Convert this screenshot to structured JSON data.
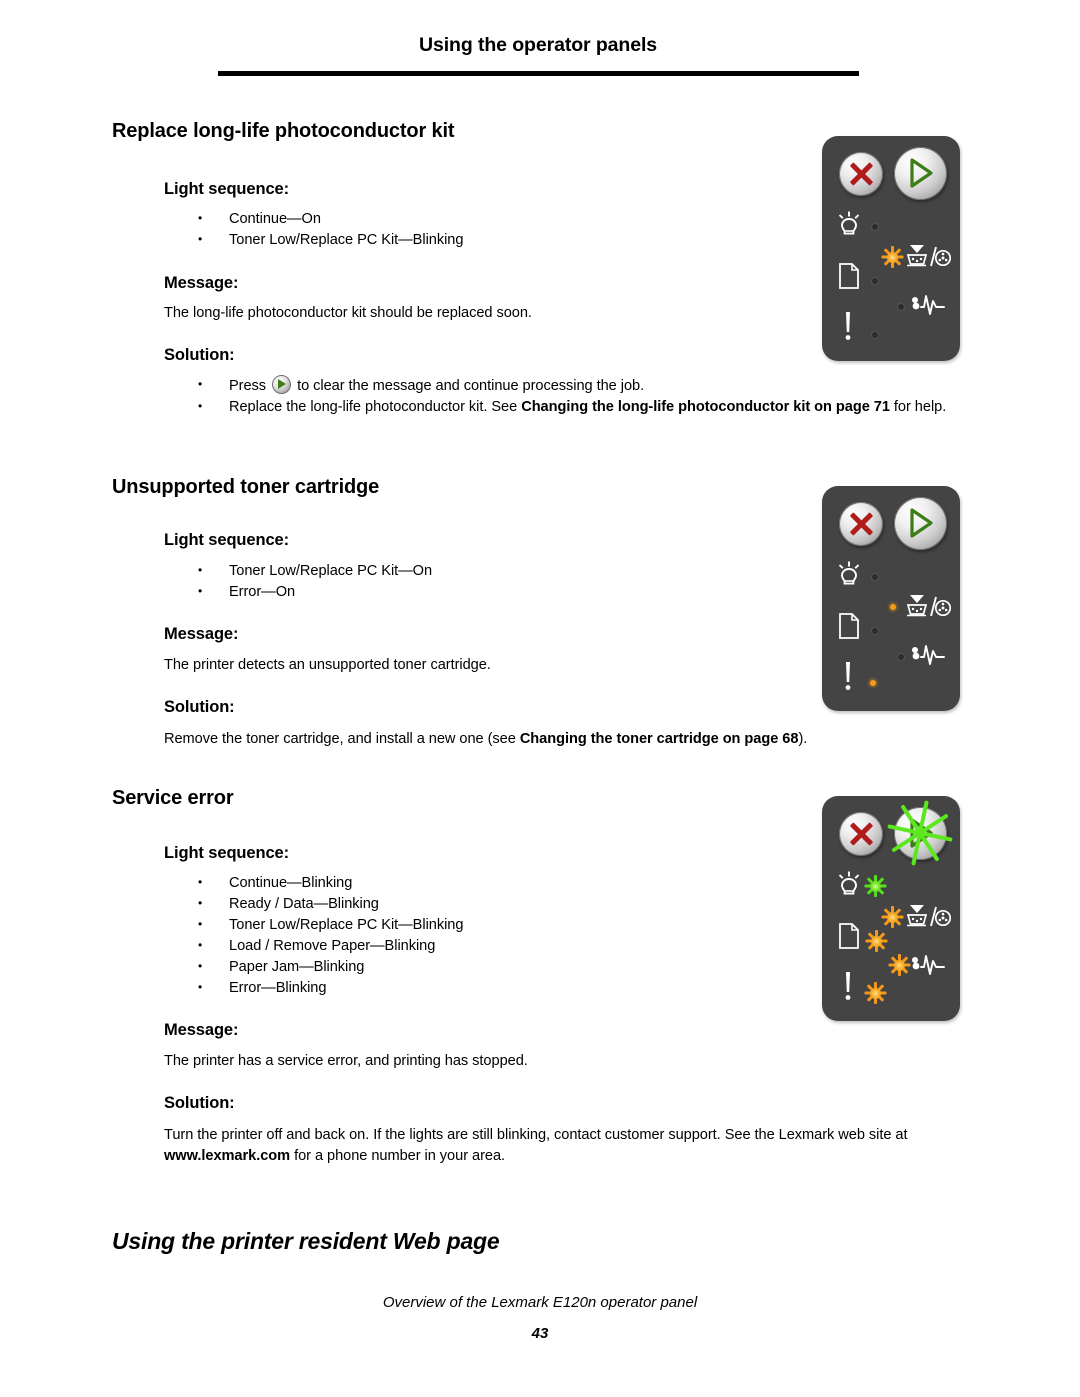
{
  "header": {
    "running_title": "Using the operator panels"
  },
  "sections": [
    {
      "title": "Replace long-life photoconductor kit",
      "light_sequence_label": "Light sequence:",
      "light_sequence": [
        "Continue—On",
        "Toner Low/Replace PC Kit—Blinking"
      ],
      "message_label": "Message:",
      "message": "The long-life photoconductor kit should be replaced soon.",
      "solution_label": "Solution:",
      "solution_bullets": [
        {
          "pre": "Press ",
          "has_button_icon": true,
          "post": " to clear the message and continue processing the job."
        },
        {
          "pre": "Replace the long-life photoconductor kit. See ",
          "bold": "Changing the long-life photoconductor kit on page 71",
          "post": " for help."
        }
      ],
      "panel": {
        "stop_button": "stop-button",
        "continue_button": "continue-button",
        "leds": {
          "ready": "off",
          "toner": "blinking",
          "paper": "off",
          "jam": "off",
          "error": "off",
          "continue": "on"
        }
      }
    },
    {
      "title": "Unsupported toner cartridge",
      "light_sequence_label": "Light sequence:",
      "light_sequence": [
        "Toner Low/Replace PC Kit—On",
        "Error—On"
      ],
      "message_label": "Message:",
      "message": "The printer detects an unsupported toner cartridge.",
      "solution_label": "Solution:",
      "solution_text": {
        "pre": "Remove the toner cartridge, and install a new one (see ",
        "bold": "Changing the toner cartridge on page 68",
        "post": ")."
      },
      "panel": {
        "leds": {
          "ready": "off",
          "toner": "on",
          "paper": "off",
          "jam": "off",
          "error": "on"
        }
      }
    },
    {
      "title": "Service error",
      "light_sequence_label": "Light sequence:",
      "light_sequence": [
        "Continue—Blinking",
        "Ready / Data—Blinking",
        "Toner Low/Replace PC Kit—Blinking",
        "Load / Remove Paper—Blinking",
        "Paper Jam—Blinking",
        "Error—Blinking"
      ],
      "message_label": "Message:",
      "message": "The printer has a service error, and printing has stopped.",
      "solution_label": "Solution:",
      "solution_text": {
        "pre": "Turn the printer off and back on. If the lights are still blinking, contact customer support. See the Lexmark web site at ",
        "bold": "www.lexmark.com",
        "post": " for a phone number in your area."
      },
      "panel": {
        "leds": {
          "continue": "blinking-green",
          "ready": "blinking-green",
          "toner": "blinking",
          "paper": "blinking",
          "jam": "blinking",
          "error": "blinking"
        }
      }
    }
  ],
  "chapter_heading": "Using the printer resident Web page",
  "footer": {
    "caption": "Overview of the Lexmark E120n operator panel",
    "page_number": "43"
  },
  "colors": {
    "panel_body": "#444444",
    "led_amber": "#f59a18",
    "led_green": "#56e01c",
    "stop_red": "#b01b1b",
    "continue_green": "#3d7d18"
  },
  "icons": {
    "ready": "lightbulb-icon",
    "toner": "toner-cartridge-icon",
    "paper": "paper-sheet-icon",
    "jam": "paper-jam-icon",
    "error": "exclamation-icon"
  }
}
